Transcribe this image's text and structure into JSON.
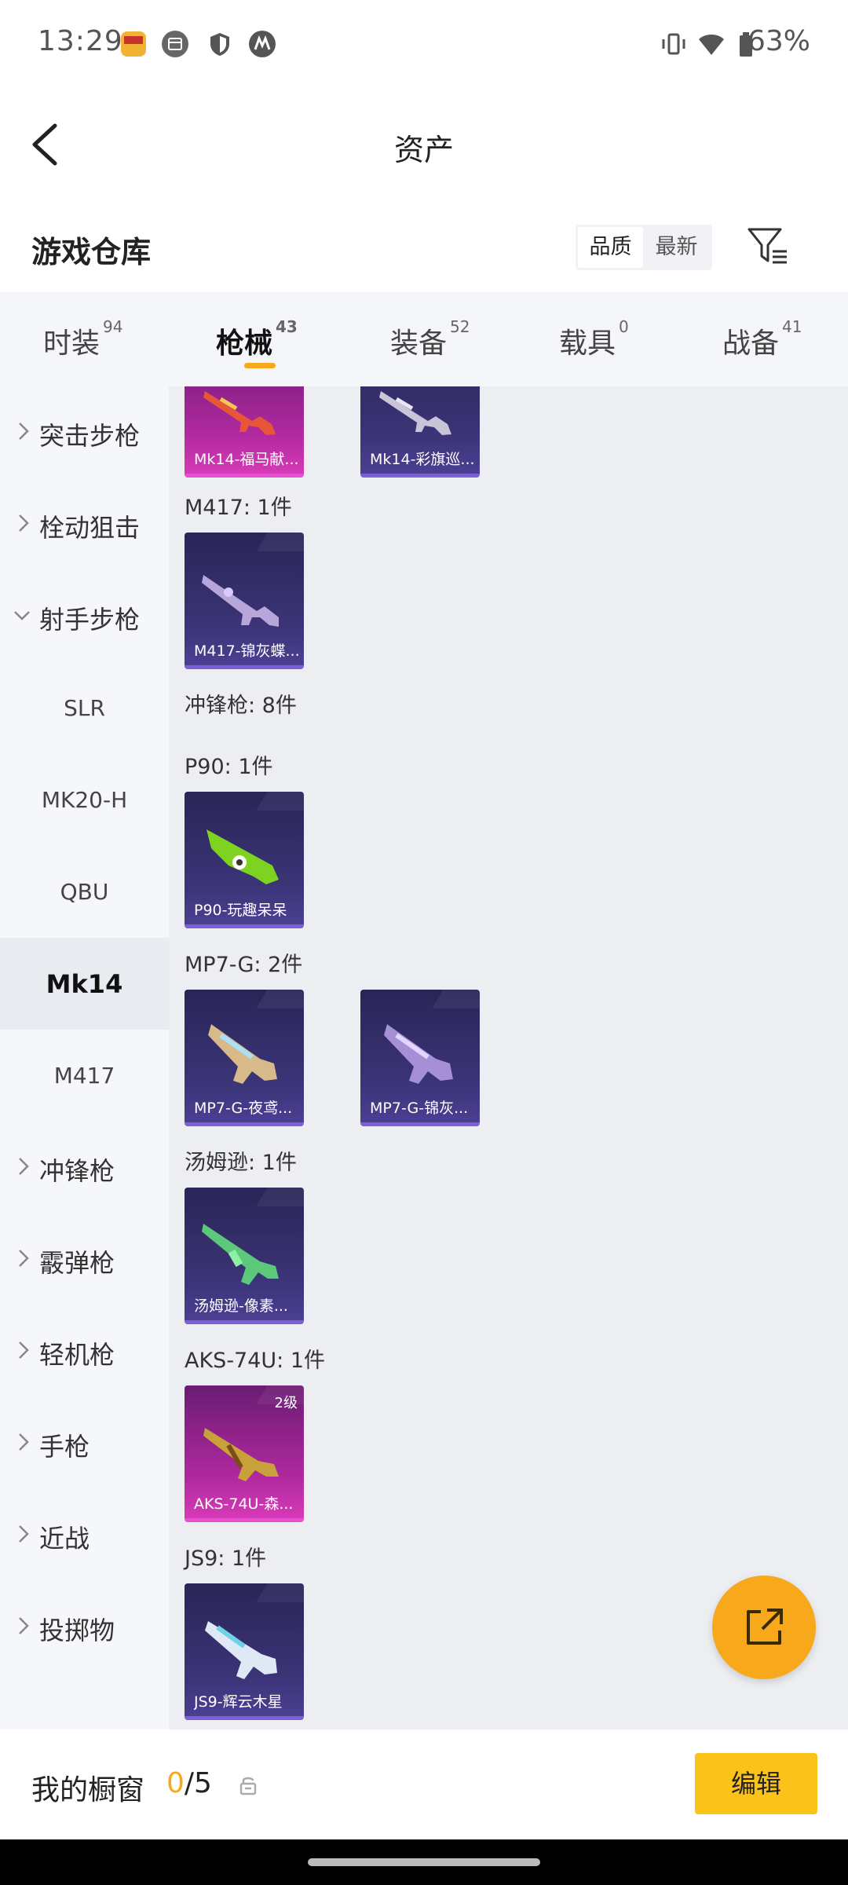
{
  "status_bar": {
    "time": "13:29",
    "battery": "63%"
  },
  "header": {
    "title": "资产"
  },
  "warehouse": {
    "title": "游戏仓库",
    "sort_options": [
      "品质",
      "最新"
    ],
    "sort_selected": "品质"
  },
  "tabs": [
    {
      "label": "时装",
      "count": "94"
    },
    {
      "label": "枪械",
      "count": "43",
      "active": true
    },
    {
      "label": "装备",
      "count": "52"
    },
    {
      "label": "载具",
      "count": "0"
    },
    {
      "label": "战备",
      "count": "41"
    }
  ],
  "sidebar": {
    "items": [
      {
        "label": "突击步枪",
        "type": "category"
      },
      {
        "label": "栓动狙击",
        "type": "category"
      },
      {
        "label": "射手步枪",
        "type": "category-expanded"
      },
      {
        "label": "SLR",
        "type": "sub"
      },
      {
        "label": "MK20-H",
        "type": "sub"
      },
      {
        "label": "QBU",
        "type": "sub"
      },
      {
        "label": "Mk14",
        "type": "sub",
        "selected": true
      },
      {
        "label": "M417",
        "type": "sub"
      },
      {
        "label": "冲锋枪",
        "type": "category"
      },
      {
        "label": "霰弹枪",
        "type": "category"
      },
      {
        "label": "轻机枪",
        "type": "category"
      },
      {
        "label": "手枪",
        "type": "category"
      },
      {
        "label": "近战",
        "type": "category"
      },
      {
        "label": "投掷物",
        "type": "category"
      }
    ]
  },
  "content": {
    "top_cards": [
      {
        "name": "Mk14-福马献...",
        "rarity": "pink"
      },
      {
        "name": "Mk14-彩旗巡...",
        "rarity": "purple"
      }
    ],
    "groups": [
      {
        "header": "M417: 1件",
        "cards": [
          {
            "name": "M417-锦灰蝶...",
            "rarity": "purple"
          }
        ]
      },
      {
        "header": "冲锋枪: 8件",
        "cards": []
      },
      {
        "header": "P90: 1件",
        "cards": [
          {
            "name": "P90-玩趣呆呆",
            "rarity": "purple"
          }
        ]
      },
      {
        "header": "MP7-G: 2件",
        "cards": [
          {
            "name": "MP7-G-夜鸢...",
            "rarity": "purple"
          },
          {
            "name": "MP7-G-锦灰...",
            "rarity": "purple"
          }
        ]
      },
      {
        "header": "汤姆逊: 1件",
        "cards": [
          {
            "name": "汤姆逊-像素...",
            "rarity": "purple"
          }
        ]
      },
      {
        "header": "AKS-74U: 1件",
        "cards": [
          {
            "name": "AKS-74U-森...",
            "rarity": "pink",
            "level": "2级"
          }
        ]
      },
      {
        "header": "JS9: 1件",
        "cards": [
          {
            "name": "JS9-辉云木星",
            "rarity": "purple"
          }
        ]
      }
    ]
  },
  "bottom_bar": {
    "title": "我的橱窗",
    "current": "0",
    "total": "/5",
    "edit_label": "编辑"
  },
  "colors": {
    "accent": "#f7a81b",
    "edit_button": "#fbc21a",
    "card_purple": "#3b3477",
    "card_pink": "#b1299f"
  },
  "icons": [
    "back-arrow-icon",
    "filter-icon",
    "chevron-right-icon",
    "chevron-down-icon",
    "share-icon",
    "lock-icon",
    "vibrate-icon",
    "wifi-icon",
    "battery-icon"
  ]
}
